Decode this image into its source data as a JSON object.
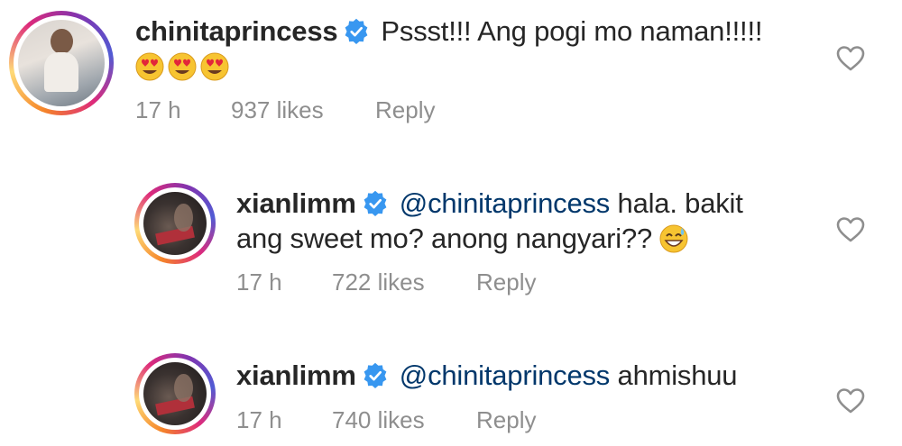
{
  "comments": [
    {
      "username": "chinitaprincess",
      "text_line1": "Pssst!!! Ang pogi mo naman!!!!!",
      "emojis": [
        "heart-eyes-emoji",
        "heart-eyes-emoji",
        "heart-eyes-emoji"
      ],
      "time": "17 h",
      "likes": "937 likes",
      "reply": "Reply"
    },
    {
      "username": "xianlimm",
      "mention": "@chinitaprincess",
      "text_line1": "hala. bakit",
      "text_line2": "ang sweet mo? anong nangyari??",
      "emojis": [
        "grinning-sweat-emoji"
      ],
      "time": "17 h",
      "likes": "722 likes",
      "reply": "Reply"
    },
    {
      "username": "xianlimm",
      "mention": "@chinitaprincess",
      "text_line1": "ahmishuu",
      "time": "17 h",
      "likes": "740 likes",
      "reply": "Reply"
    }
  ],
  "colors": {
    "text": "#262626",
    "mention": "#00376b",
    "meta": "#8e8e8e",
    "verified": "#3897f0"
  }
}
